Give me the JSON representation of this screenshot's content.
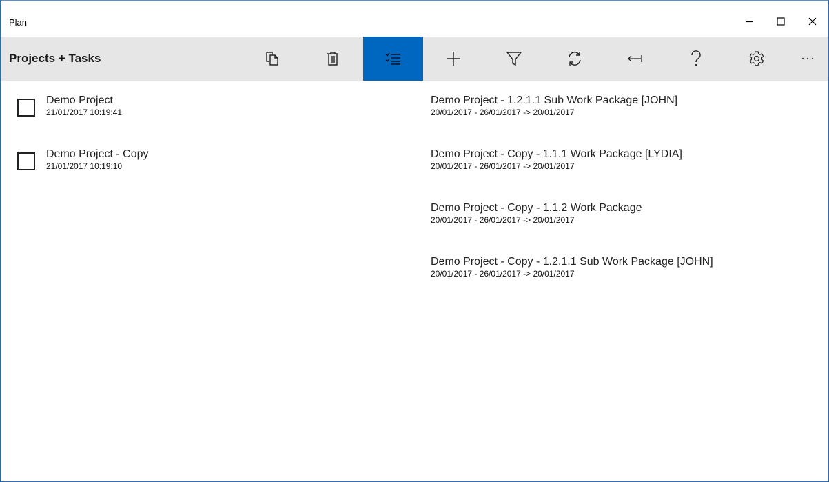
{
  "window": {
    "title": "Plan"
  },
  "caption_buttons": {
    "minimize": "minimize-icon",
    "maximize": "maximize-icon",
    "close": "close-icon"
  },
  "commandbar": {
    "title": "Projects + Tasks",
    "buttons": [
      {
        "icon": "copy-icon",
        "active": false
      },
      {
        "icon": "delete-icon",
        "active": false
      },
      {
        "icon": "checklist-icon",
        "active": true
      },
      {
        "icon": "add-icon",
        "active": false
      },
      {
        "icon": "filter-icon",
        "active": false
      },
      {
        "icon": "refresh-icon",
        "active": false
      },
      {
        "icon": "back-arrow-icon",
        "active": false
      },
      {
        "icon": "help-icon",
        "active": false
      },
      {
        "icon": "settings-icon",
        "active": false
      },
      {
        "icon": "more-icon",
        "active": false
      }
    ],
    "accent_color": "#0067c0",
    "background_color": "#e6e6e6"
  },
  "projects": [
    {
      "name": "Demo Project",
      "timestamp": "21/01/2017 10:19:41",
      "checked": false
    },
    {
      "name": "Demo Project - Copy",
      "timestamp": "21/01/2017 10:19:10",
      "checked": false
    }
  ],
  "tasks": [
    {
      "title": "Demo Project - 1.2.1.1 Sub Work Package [JOHN]",
      "dates": "20/01/2017 - 26/01/2017 -> 20/01/2017"
    },
    {
      "title": "Demo Project - Copy - 1.1.1 Work Package [LYDIA]",
      "dates": "20/01/2017 - 26/01/2017 -> 20/01/2017"
    },
    {
      "title": "Demo Project - Copy - 1.1.2 Work Package",
      "dates": "20/01/2017 - 26/01/2017 -> 20/01/2017"
    },
    {
      "title": "Demo Project - Copy - 1.2.1.1 Sub Work Package [JOHN]",
      "dates": "20/01/2017 - 26/01/2017 -> 20/01/2017"
    }
  ]
}
